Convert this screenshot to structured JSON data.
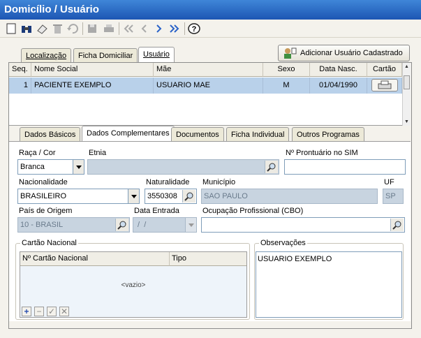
{
  "window": {
    "title": "Domicílio / Usuário"
  },
  "toolbar": {
    "items": [
      "new-icon",
      "find-icon",
      "eraser-icon",
      "trash-icon",
      "undo-icon",
      "save-icon",
      "print-icon",
      "first-icon",
      "prev-icon",
      "next-icon",
      "last-icon",
      "help-icon"
    ]
  },
  "top_tabs": [
    {
      "label": "Localização",
      "active": false
    },
    {
      "label": "Ficha Domiciliar",
      "active": false
    },
    {
      "label": "Usuário",
      "active": true
    }
  ],
  "add_user_button": "Adicionar Usuário Cadastrado",
  "grid": {
    "columns": [
      "Seq.",
      "Nome Social",
      "Mãe",
      "Sexo",
      "Data Nasc.",
      "Cartão"
    ],
    "rows": [
      {
        "seq": "1",
        "nome": "PACIENTE EXEMPLO",
        "mae": "USUARIO MAE",
        "sexo": "M",
        "data_nasc": "01/04/1990"
      }
    ]
  },
  "sub_tabs": [
    {
      "label": "Dados Básicos",
      "active": false
    },
    {
      "label": "Dados Complementares",
      "active": true
    },
    {
      "label": "Documentos",
      "active": false
    },
    {
      "label": "Ficha Individual",
      "active": false
    },
    {
      "label": "Outros Programas",
      "active": false
    }
  ],
  "form": {
    "raca_label": "Raça / Cor",
    "raca_value": "Branca",
    "etnia_label": "Etnia",
    "etnia_value": "",
    "prontuario_label": "Nº Prontuário no SIM",
    "prontuario_value": "",
    "nacionalidade_label": "Nacionalidade",
    "nacionalidade_value": "BRASILEIRO",
    "naturalidade_label": "Naturalidade",
    "naturalidade_value": "3550308",
    "municipio_label": "Município",
    "municipio_value": "SAO PAULO",
    "uf_label": "UF",
    "uf_value": "SP",
    "pais_label": "País de Origem",
    "pais_value": "10 - BRASIL",
    "data_entrada_label": "Data Entrada",
    "data_entrada_value": " /  /",
    "ocupacao_label": "Ocupação Profissional (CBO)",
    "ocupacao_value": ""
  },
  "cartao": {
    "group_title": "Cartão Nacional",
    "columns": [
      "Nº Cartão Nacional",
      "Tipo"
    ],
    "empty": "<vazio>"
  },
  "observacoes": {
    "group_title": "Observações",
    "value": "USUARIO EXEMPLO"
  }
}
